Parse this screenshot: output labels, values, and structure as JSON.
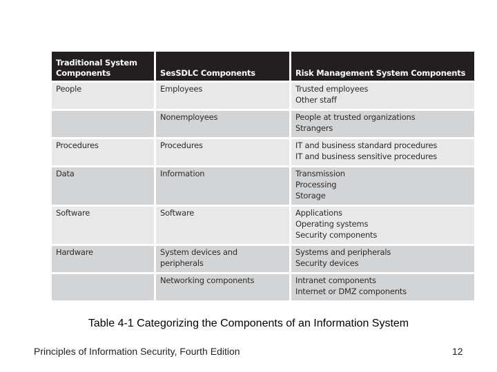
{
  "table": {
    "headers": [
      "Traditional System Components",
      "SesSDLC  Components",
      "Risk Management System Components"
    ],
    "rows": [
      {
        "style": "light",
        "size": "h38",
        "cells": [
          [
            "People"
          ],
          [
            "Employees"
          ],
          [
            "Trusted employees",
            "Other staff"
          ]
        ]
      },
      {
        "style": "dark",
        "size": "h38",
        "cells": [
          [],
          [
            "Nonemployees"
          ],
          [
            "People at trusted organizations",
            "Strangers"
          ]
        ]
      },
      {
        "style": "light",
        "size": "h38",
        "cells": [
          [
            "Procedures"
          ],
          [
            "Procedures"
          ],
          [
            "IT and business standard procedures",
            "IT and business sensitive procedures"
          ]
        ]
      },
      {
        "style": "dark",
        "size": "h54",
        "cells": [
          [
            "Data"
          ],
          [
            "Information"
          ],
          [
            "Transmission",
            "Processing",
            "Storage"
          ]
        ]
      },
      {
        "style": "light",
        "size": "h54",
        "cells": [
          [
            "Software"
          ],
          [
            "Software"
          ],
          [
            "Applications",
            "Operating systems",
            "Security components"
          ]
        ]
      },
      {
        "style": "dark",
        "size": "h38",
        "cells": [
          [
            "Hardware"
          ],
          [
            "System devices and",
            "peripherals"
          ],
          [
            "Systems and peripherals",
            "Security devices"
          ]
        ]
      },
      {
        "style": "dark",
        "size": "h38",
        "cells": [
          [],
          [
            "Networking components"
          ],
          [
            "Intranet components",
            "Internet or DMZ components"
          ]
        ]
      }
    ]
  },
  "caption": "Table 4-1 Categorizing the Components of an Information System",
  "footer": {
    "book_title": "Principles of Information Security, Fourth Edition",
    "page_number": "12"
  }
}
